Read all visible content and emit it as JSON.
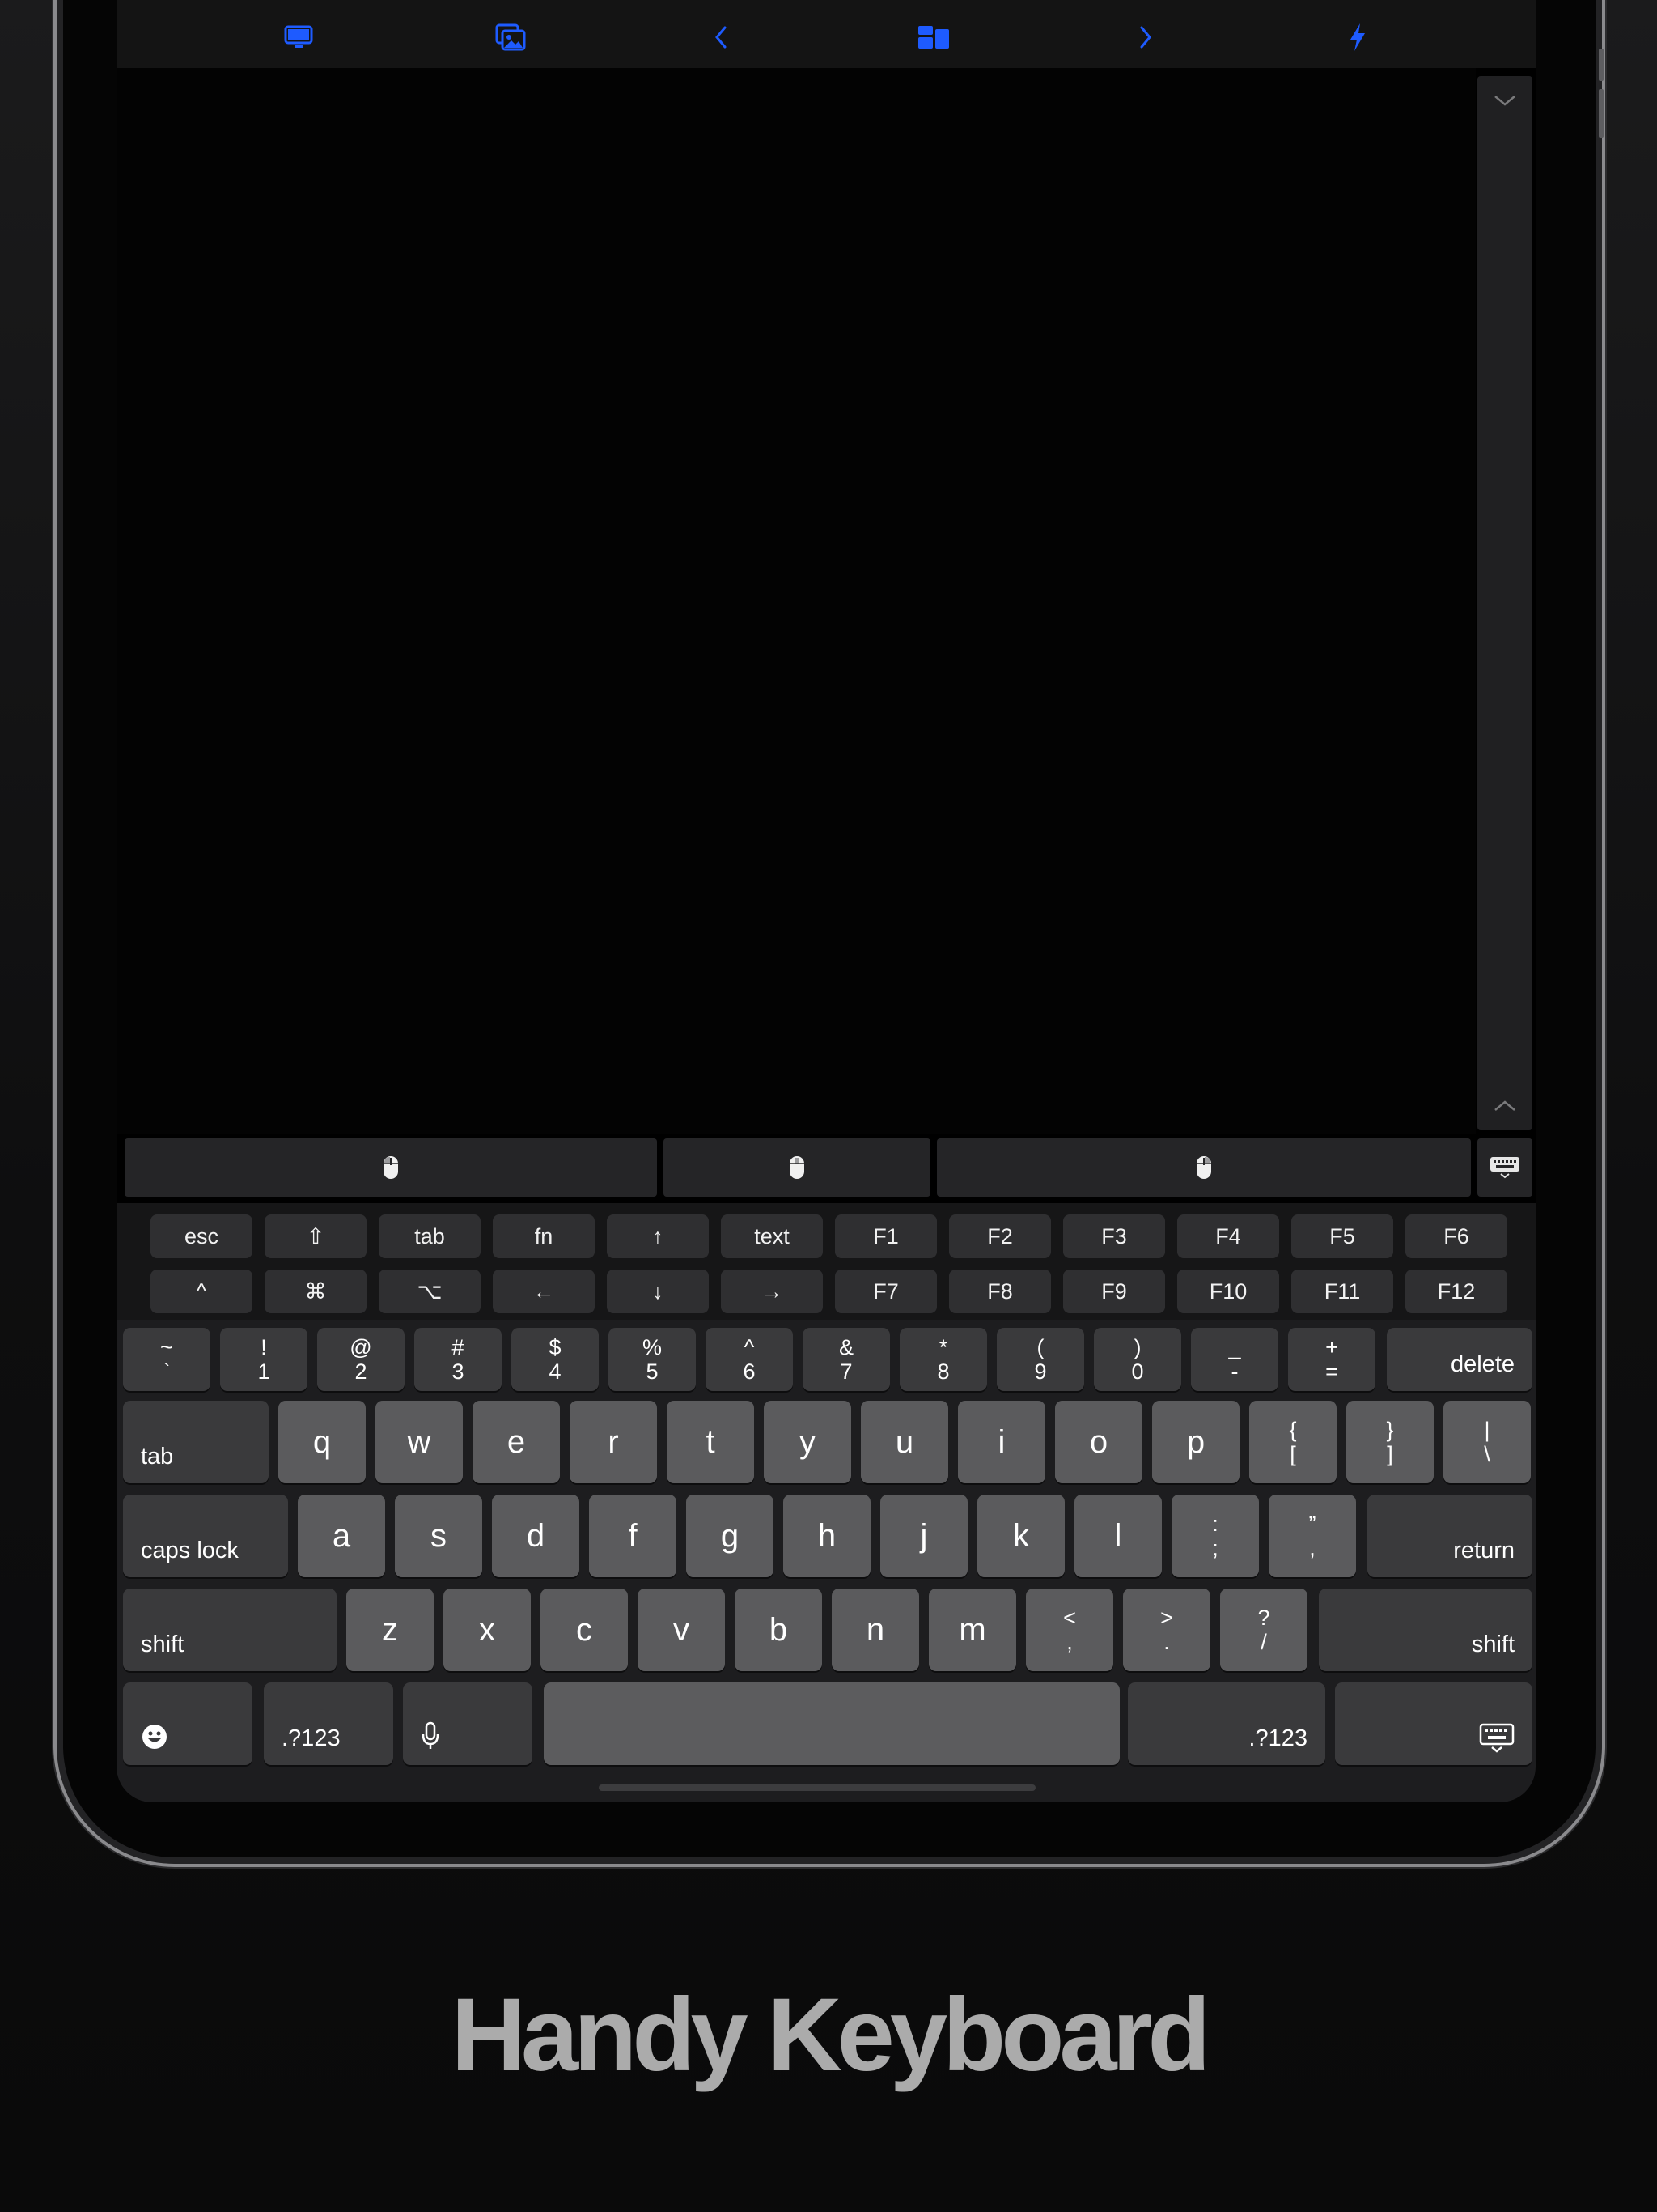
{
  "toolbar": {
    "icons": [
      "monitor-icon",
      "photo-stack-icon",
      "chevron-left-icon",
      "layout-icon",
      "chevron-right-icon",
      "lightning-icon"
    ],
    "accent": "#1e5bff"
  },
  "mouse_buttons": [
    "mouse-left-button",
    "mouse-middle-button",
    "mouse-right-button"
  ],
  "function_rows": {
    "row1": [
      "esc",
      "⇧",
      "tab",
      "fn",
      "↑",
      "text",
      "F1",
      "F2",
      "F3",
      "F4",
      "F5",
      "F6"
    ],
    "row2": [
      "^",
      "⌘",
      "⌥",
      "←",
      "↓",
      "→",
      "F7",
      "F8",
      "F9",
      "F10",
      "F11",
      "F12"
    ]
  },
  "keyboard": {
    "number_row": [
      {
        "top": "~",
        "bottom": "`"
      },
      {
        "top": "!",
        "bottom": "1"
      },
      {
        "top": "@",
        "bottom": "2"
      },
      {
        "top": "#",
        "bottom": "3"
      },
      {
        "top": "$",
        "bottom": "4"
      },
      {
        "top": "%",
        "bottom": "5"
      },
      {
        "top": "^",
        "bottom": "6"
      },
      {
        "top": "&",
        "bottom": "7"
      },
      {
        "top": "*",
        "bottom": "8"
      },
      {
        "top": "(",
        "bottom": "9"
      },
      {
        "top": ")",
        "bottom": "0"
      },
      {
        "top": "_",
        "bottom": "-"
      },
      {
        "top": "+",
        "bottom": "="
      }
    ],
    "delete": "delete",
    "tab": "tab",
    "row_q": [
      "q",
      "w",
      "e",
      "r",
      "t",
      "y",
      "u",
      "i",
      "o",
      "p"
    ],
    "row_q_symbols": [
      {
        "top": "{",
        "bottom": "["
      },
      {
        "top": "}",
        "bottom": "]"
      },
      {
        "top": "|",
        "bottom": "\\"
      }
    ],
    "caps_lock": "caps lock",
    "row_a": [
      "a",
      "s",
      "d",
      "f",
      "g",
      "h",
      "j",
      "k",
      "l"
    ],
    "row_a_symbols": [
      {
        "top": ":",
        "bottom": ";"
      },
      {
        "top": "”",
        "bottom": ","
      }
    ],
    "return": "return",
    "shift": "shift",
    "row_z": [
      "z",
      "x",
      "c",
      "v",
      "b",
      "n",
      "m"
    ],
    "row_z_symbols": [
      {
        "top": "<",
        "bottom": ","
      },
      {
        "top": ">",
        "bottom": "."
      },
      {
        "top": "?",
        "bottom": "/"
      }
    ],
    "numeric_switch": ".?123",
    "icons": [
      "emoji-icon",
      "microphone-icon",
      "keyboard-dismiss-icon"
    ]
  },
  "caption": "Handy Keyboard"
}
